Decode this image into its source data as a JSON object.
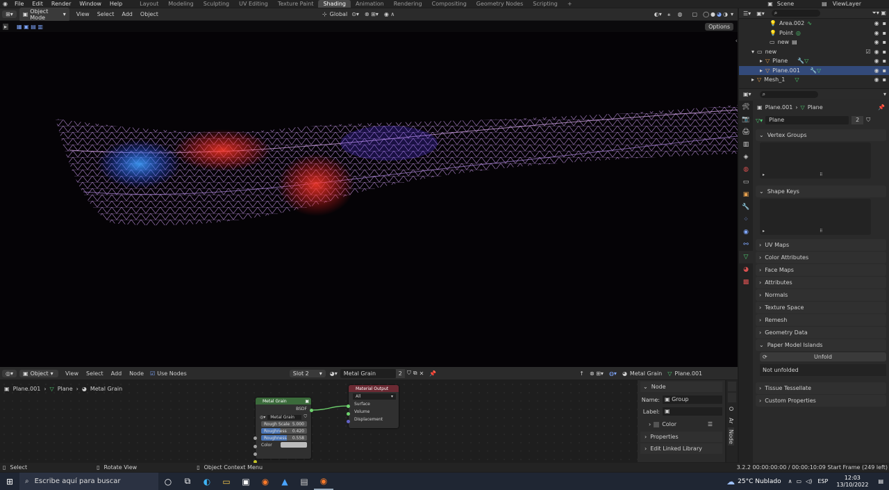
{
  "topmenu": {
    "items": [
      "File",
      "Edit",
      "Render",
      "Window",
      "Help"
    ]
  },
  "workspaces": [
    "Layout",
    "Modeling",
    "Sculpting",
    "UV Editing",
    "Texture Paint",
    "Shading",
    "Animation",
    "Rendering",
    "Compositing",
    "Geometry Nodes",
    "Scripting"
  ],
  "active_workspace": "Shading",
  "scene": "Scene",
  "view_layer": "ViewLayer",
  "viewport": {
    "mode": "Object Mode",
    "menus": [
      "View",
      "Select",
      "Add",
      "Object"
    ],
    "transform": "Global",
    "options": "Options"
  },
  "outliner": {
    "rows": [
      {
        "label": "Area.002",
        "indent": 3,
        "icon": "light-icon"
      },
      {
        "label": "Point",
        "indent": 3,
        "icon": "light-icon"
      },
      {
        "label": "new",
        "indent": 2,
        "icon": "collection-icon"
      },
      {
        "label": "new",
        "indent": 1,
        "icon": "collection-icon"
      },
      {
        "label": "Plane",
        "indent": 2,
        "icon": "mesh-icon"
      },
      {
        "label": "Plane.001",
        "indent": 2,
        "icon": "mesh-icon",
        "selected": true
      },
      {
        "label": "Mesh_1",
        "indent": 1,
        "icon": "mesh-icon"
      }
    ]
  },
  "properties": {
    "breadcrumb": [
      "Plane.001",
      "Plane"
    ],
    "mesh_name": "Plane",
    "users": "2",
    "panels": [
      "Vertex Groups",
      "Shape Keys",
      "UV Maps",
      "Color Attributes",
      "Face Maps",
      "Attributes",
      "Normals",
      "Texture Space",
      "Remesh",
      "Geometry Data",
      "Paper Model Islands"
    ],
    "unfold": "Unfold",
    "not_unfolded": "Not unfolded",
    "bottom_panels": [
      "Tissue Tessellate",
      "Custom Properties"
    ]
  },
  "node_editor": {
    "object": "Object",
    "menus": [
      "View",
      "Select",
      "Add",
      "Node"
    ],
    "use_nodes": "Use Nodes",
    "slot": "Slot 2",
    "material": "Metal Grain",
    "material_users": "2",
    "breadcrumb": [
      "Plane.001",
      "Plane",
      "Metal Grain"
    ],
    "right_material": "Metal Grain",
    "right_object": "Plane.001"
  },
  "group_node": {
    "title": "Metal Grain",
    "output": "BSDF",
    "datablock": "Metal Grain",
    "fields": [
      {
        "label": "Rough Scale",
        "value": "5.000"
      },
      {
        "label": "Roughness",
        "value": "0.420"
      },
      {
        "label": "Roughness",
        "value": "0.558"
      }
    ],
    "color_label": "Color"
  },
  "output_node": {
    "title": "Material Output",
    "target": "All",
    "inputs": [
      "Surface",
      "Volume",
      "Displacement"
    ]
  },
  "npanel": {
    "section": "Node",
    "name_label": "Name:",
    "name_value": "Group",
    "label_label": "Label:",
    "color": "Color",
    "properties": "Properties",
    "edit_linked": "Edit Linked Library",
    "tabs": [
      "Node",
      "Ar",
      "O"
    ]
  },
  "statusbar": {
    "select": "Select",
    "rotate": "Rotate View",
    "context": "Object Context Menu",
    "version": "3.2.2  00:00:00:00 / 00:00:10:09  Start Frame (249 left)"
  },
  "taskbar": {
    "search": "Escribe aquí para buscar",
    "weather": "25°C  Nublado",
    "lang": "ESP",
    "time": "12:03",
    "date": "13/10/2022"
  }
}
